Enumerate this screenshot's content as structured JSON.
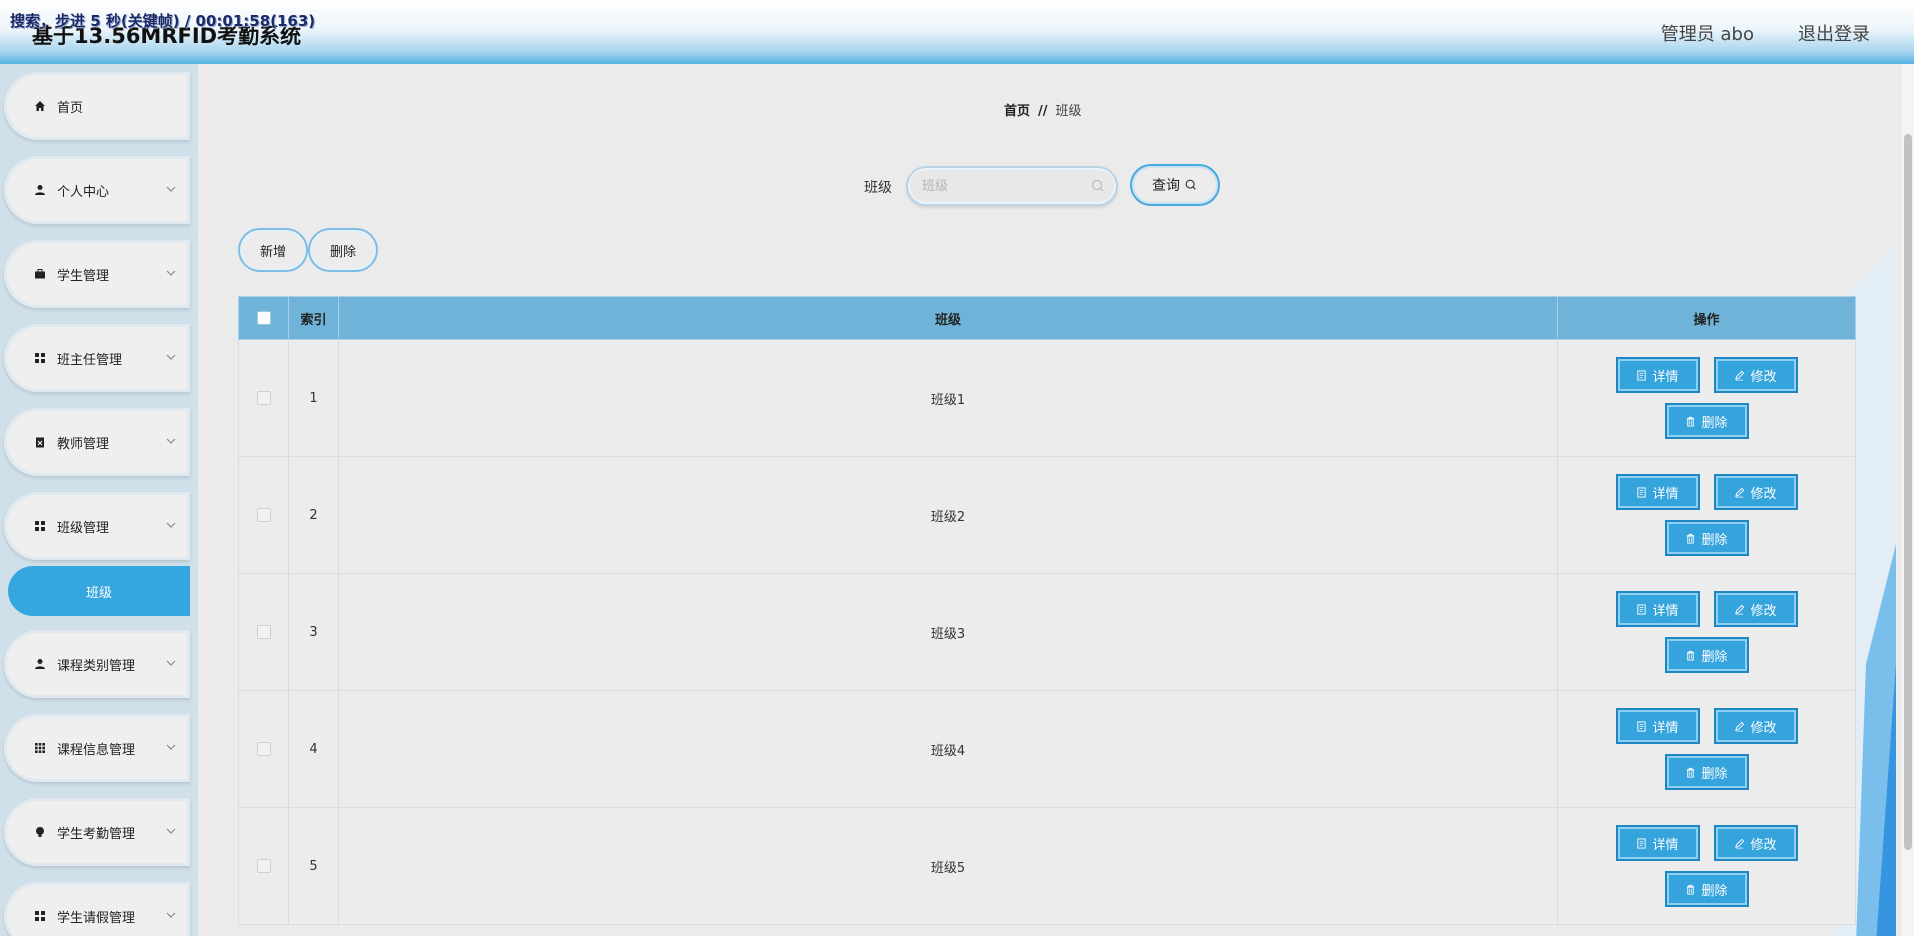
{
  "overlay": {
    "text": "搜索，步进 5 秒(关键帧) / 00:01:58(163)"
  },
  "header": {
    "title": "基于13.56MRFID考勤系统",
    "user": "管理员 abo",
    "logout": "退出登录"
  },
  "sidebar": {
    "items": [
      {
        "label": "首页",
        "icon": "home-icon"
      },
      {
        "label": "个人中心",
        "icon": "person-icon"
      },
      {
        "label": "学生管理",
        "icon": "briefcase-icon"
      },
      {
        "label": "班主任管理",
        "icon": "grid-icon"
      },
      {
        "label": "教师管理",
        "icon": "clipboard-icon"
      },
      {
        "label": "班级管理",
        "icon": "grid-icon"
      },
      {
        "label": "课程类别管理",
        "icon": "person-icon"
      },
      {
        "label": "课程信息管理",
        "icon": "apps-icon"
      },
      {
        "label": "学生考勤管理",
        "icon": "lightbulb-icon"
      },
      {
        "label": "学生请假管理",
        "icon": "grid-icon"
      }
    ],
    "active_sub": "班级"
  },
  "breadcrumb": {
    "home": "首页",
    "sep": "//",
    "current": "班级"
  },
  "search": {
    "label": "班级",
    "placeholder": "班级",
    "value": "",
    "button": "查询"
  },
  "actions": {
    "add": "新增",
    "delete": "删除"
  },
  "table": {
    "headers": {
      "index": "索引",
      "class": "班级",
      "ops": "操作"
    },
    "rows": [
      {
        "index": "1",
        "class": "班级1"
      },
      {
        "index": "2",
        "class": "班级2"
      },
      {
        "index": "3",
        "class": "班级3"
      },
      {
        "index": "4",
        "class": "班级4"
      },
      {
        "index": "5",
        "class": "班级5"
      }
    ],
    "row_buttons": {
      "detail": "详情",
      "edit": "修改",
      "delete": "删除"
    }
  },
  "colors": {
    "accent": "#35a3dc",
    "header_row": "#6fb3d8",
    "sidebar_bg": "#cfe0ea"
  }
}
